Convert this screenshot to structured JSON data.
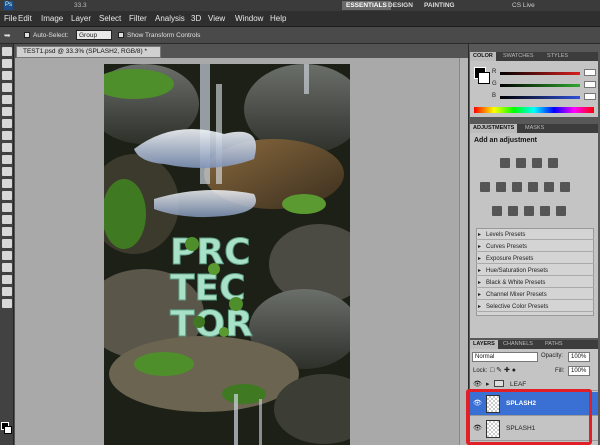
{
  "appbar": {
    "brand": "Ps",
    "zoom": "33.3",
    "workspaces": [
      "ESSENTIALS",
      "DESIGN",
      "PAINTING"
    ],
    "cslive": "CS Live"
  },
  "menu": [
    "File",
    "Edit",
    "Image",
    "Layer",
    "Select",
    "Filter",
    "Analysis",
    "3D",
    "View",
    "Window",
    "Help"
  ],
  "options": {
    "auto_select_label": "Auto-Select:",
    "auto_select_value": "Group",
    "transform_label": "Show Transform Controls"
  },
  "document": {
    "tab_title": "TEST1.psd @ 33.3% (SPLASH2, RGB/8) *"
  },
  "artwork": {
    "lines": [
      "PRC",
      "TEC",
      "TOR"
    ]
  },
  "panels": {
    "color_tabs": [
      "COLOR",
      "SWATCHES",
      "STYLES"
    ],
    "color_sliders": [
      {
        "label": "R",
        "color": "#d82020"
      },
      {
        "label": "G",
        "color": "#2fa82f"
      },
      {
        "label": "B",
        "color": "#2f4fd8"
      }
    ],
    "adjust_tabs": [
      "ADJUSTMENTS",
      "MASKS"
    ],
    "adjust_heading": "Add an adjustment",
    "presets": [
      "Levels Presets",
      "Curves Presets",
      "Exposure Presets",
      "Hue/Saturation Presets",
      "Black & White Presets",
      "Channel Mixer Presets",
      "Selective Color Presets"
    ],
    "layer_tabs": [
      "LAYERS",
      "CHANNELS",
      "PATHS"
    ],
    "blend_mode": "Normal",
    "opacity_label": "Opacity:",
    "opacity_value": "100%",
    "lock_label": "Lock:",
    "fill_label": "Fill:",
    "fill_value": "100%",
    "layers": [
      {
        "name": "LEAF",
        "type": "group"
      },
      {
        "name": "SPLASH2",
        "type": "layer",
        "selected": true
      },
      {
        "name": "SPLASH1",
        "type": "layer",
        "selected": false
      }
    ]
  },
  "colors": {
    "selection_blue": "#3a6fd3",
    "highlight_red": "#e01f26",
    "moss_green": "#4e8f2c",
    "text_mint": "#a8e0c8"
  }
}
